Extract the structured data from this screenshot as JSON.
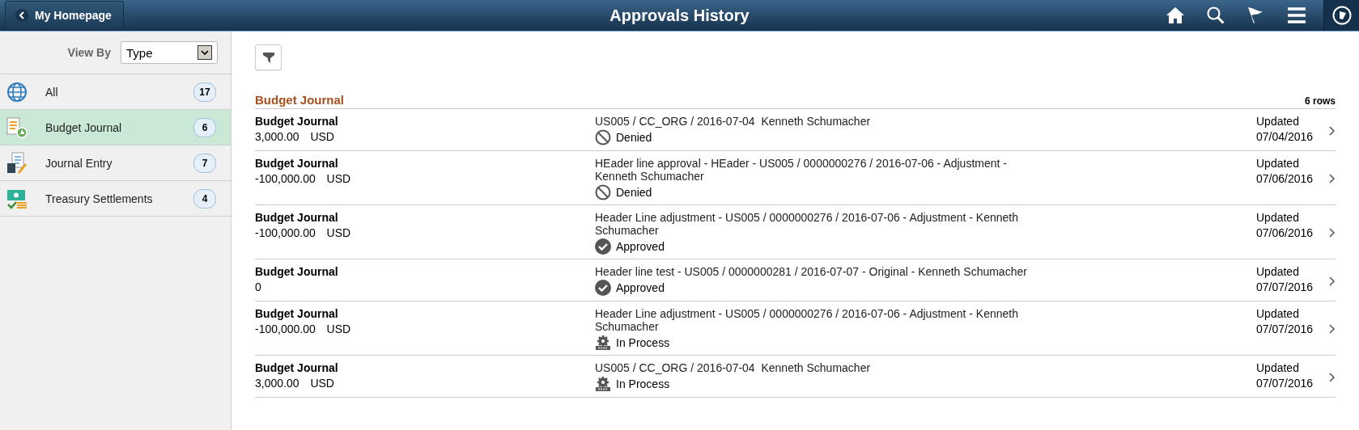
{
  "header": {
    "back_button": "My Homepage",
    "title": "Approvals History"
  },
  "sidebar": {
    "view_by": {
      "label": "View By",
      "value": "Type"
    },
    "items": [
      {
        "label": "All",
        "count": "17",
        "kind": "globe",
        "selected": false
      },
      {
        "label": "Budget Journal",
        "count": "6",
        "kind": "budget",
        "selected": true
      },
      {
        "label": "Journal Entry",
        "count": "7",
        "kind": "journal",
        "selected": false
      },
      {
        "label": "Treasury Settlements",
        "count": "4",
        "kind": "treasury",
        "selected": false
      }
    ]
  },
  "content": {
    "section_title": "Budget Journal",
    "row_count": "6 rows",
    "rows": [
      {
        "type": "Budget Journal",
        "amount": "3,000.00",
        "currency": "USD",
        "description": "US005 / CC_ORG / 2016-07-04  Kenneth Schumacher",
        "status": {
          "kind": "denied",
          "label": "Denied"
        },
        "updated_label": "Updated",
        "date": "07/04/2016"
      },
      {
        "type": "Budget Journal",
        "amount": "-100,000.00",
        "currency": "USD",
        "description": "HEader line approval - HEader - US005 / 0000000276 / 2016-07-06 - Adjustment - Kenneth Schumacher",
        "status": {
          "kind": "denied",
          "label": "Denied"
        },
        "updated_label": "Updated",
        "date": "07/06/2016"
      },
      {
        "type": "Budget Journal",
        "amount": "-100,000.00",
        "currency": "USD",
        "description": "Header Line adjustment - US005 / 0000000276 / 2016-07-06 - Adjustment - Kenneth Schumacher",
        "status": {
          "kind": "approved",
          "label": "Approved"
        },
        "updated_label": "Updated",
        "date": "07/06/2016"
      },
      {
        "type": "Budget Journal",
        "amount": "0",
        "currency": "",
        "description": "Header line test - US005 / 0000000281 / 2016-07-07 - Original - Kenneth Schumacher",
        "status": {
          "kind": "approved",
          "label": "Approved"
        },
        "updated_label": "Updated",
        "date": "07/07/2016"
      },
      {
        "type": "Budget Journal",
        "amount": "-100,000.00",
        "currency": "USD",
        "description": "Header Line adjustment - US005 / 0000000276 / 2016-07-06 - Adjustment - Kenneth Schumacher",
        "status": {
          "kind": "in_process",
          "label": "In Process"
        },
        "updated_label": "Updated",
        "date": "07/07/2016"
      },
      {
        "type": "Budget Journal",
        "amount": "3,000.00",
        "currency": "USD",
        "description": "US005 / CC_ORG / 2016-07-04  Kenneth Schumacher",
        "status": {
          "kind": "in_process",
          "label": "In Process"
        },
        "updated_label": "Updated",
        "date": "07/07/2016"
      }
    ]
  }
}
